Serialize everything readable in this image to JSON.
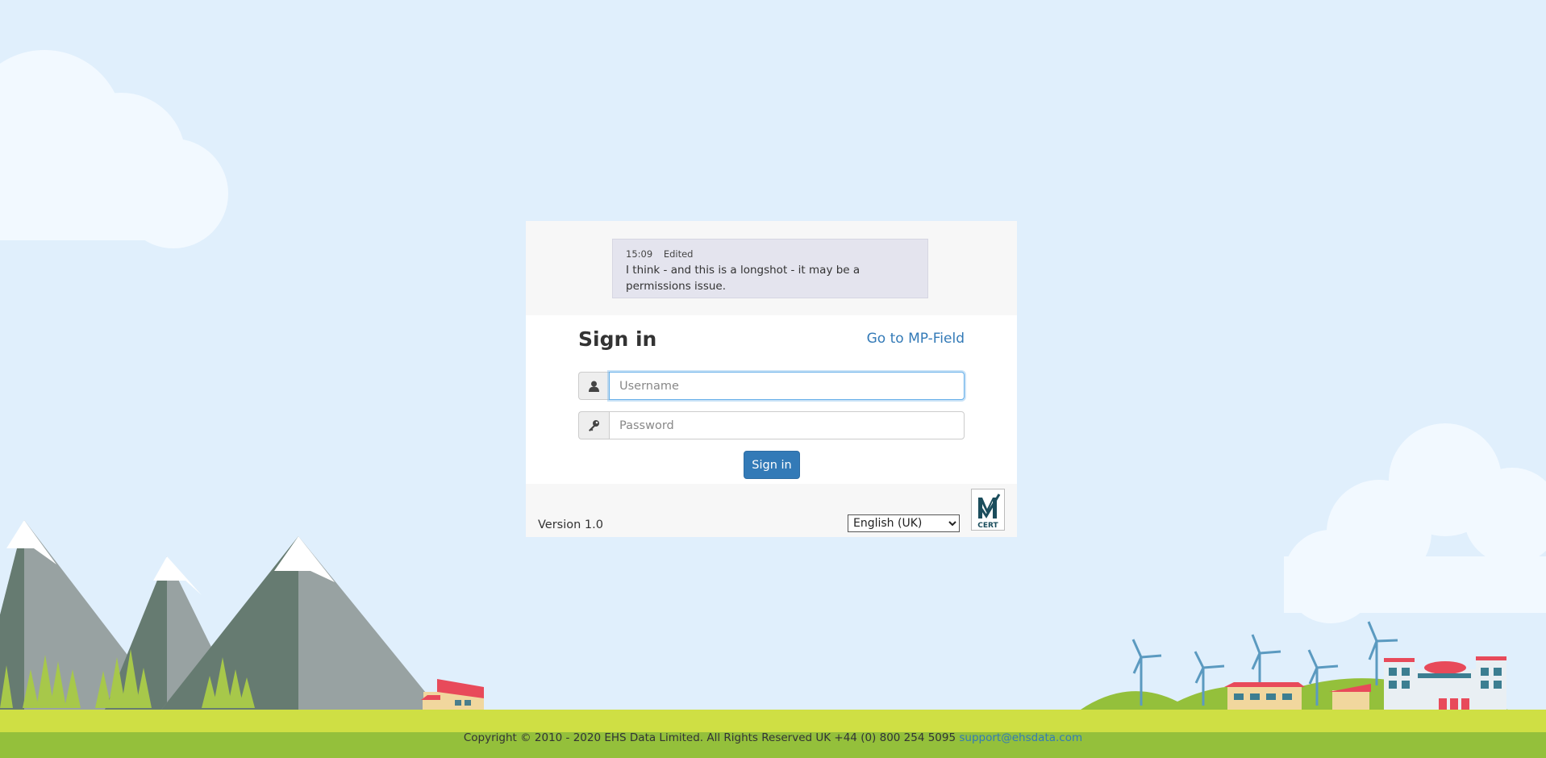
{
  "message": {
    "time": "15:09",
    "status": "Edited",
    "text": "I think - and this is a longshot - it may be a permissions issue."
  },
  "signin": {
    "title": "Sign in",
    "mp_field_link": "Go to MP-Field",
    "username_placeholder": "Username",
    "password_placeholder": "Password",
    "button_label": "Sign in"
  },
  "bottom": {
    "version": "Version 1.0",
    "language_selected": "English (UK)"
  },
  "footer": {
    "copyright": "Copyright © 2010 - 2020 EHS Data Limited. All Rights Reserved UK +44 (0) 800 254 5095",
    "email": "support@ehsdata.com"
  },
  "icons": {
    "user": "user-icon",
    "password": "key-icon",
    "logo": "cert-logo"
  },
  "logo": {
    "text": "CERT"
  },
  "colors": {
    "sky": "#e0effc",
    "grass_light": "#cfdf44",
    "grass_dark": "#94c03b",
    "primary": "#337ab7"
  }
}
